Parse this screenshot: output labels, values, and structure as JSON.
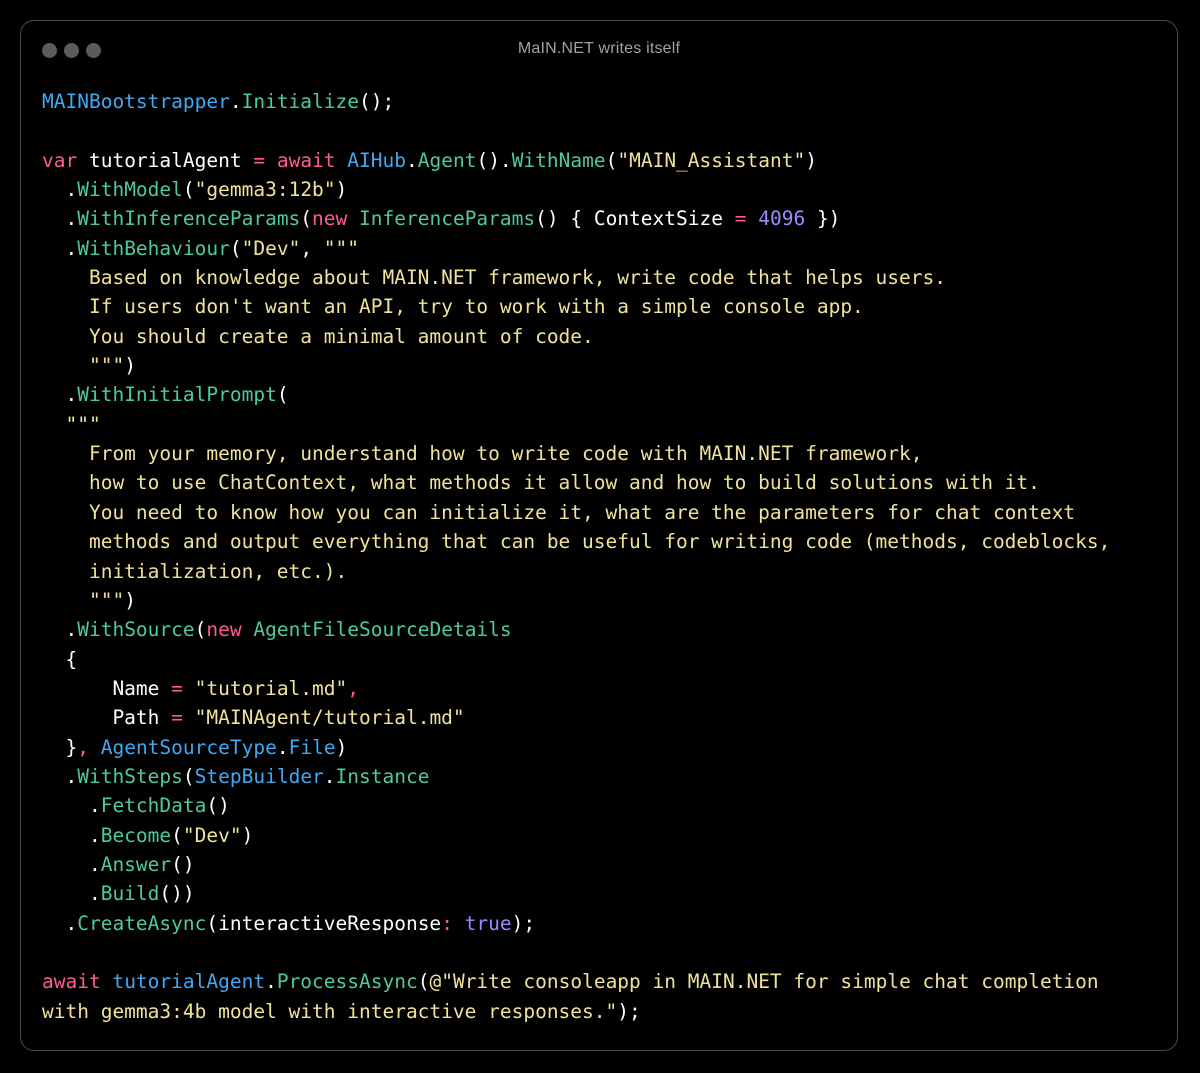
{
  "window": {
    "title": "MaIN.NET writes itself"
  },
  "colors": {
    "background": "#000000",
    "window_border": "#4a4a4c",
    "traffic_light": "#5b5b5e",
    "type": "#3fa9f5",
    "method": "#4ec9a4",
    "keyword": "#ff5c8a",
    "string": "#f0e29a",
    "number": "#9e88ff",
    "plain": "#ffffff"
  },
  "code": {
    "lines": [
      [
        [
          "type",
          "MAINBootstrapper"
        ],
        [
          "plain",
          "."
        ],
        [
          "method",
          "Initialize"
        ],
        [
          "plain",
          "();"
        ]
      ],
      [],
      [
        [
          "kw",
          "var"
        ],
        [
          "plain",
          " tutorialAgent "
        ],
        [
          "op",
          "="
        ],
        [
          "plain",
          " "
        ],
        [
          "kw",
          "await"
        ],
        [
          "plain",
          " "
        ],
        [
          "type",
          "AIHub"
        ],
        [
          "plain",
          "."
        ],
        [
          "method",
          "Agent"
        ],
        [
          "plain",
          "()."
        ],
        [
          "method",
          "WithName"
        ],
        [
          "plain",
          "("
        ],
        [
          "str",
          "\"MAIN_Assistant\""
        ],
        [
          "plain",
          ")"
        ]
      ],
      [
        [
          "plain",
          "  ."
        ],
        [
          "method",
          "WithModel"
        ],
        [
          "plain",
          "("
        ],
        [
          "str",
          "\"gemma3:12b\""
        ],
        [
          "plain",
          ")"
        ]
      ],
      [
        [
          "plain",
          "  ."
        ],
        [
          "method",
          "WithInferenceParams"
        ],
        [
          "plain",
          "("
        ],
        [
          "kw",
          "new"
        ],
        [
          "plain",
          " "
        ],
        [
          "method",
          "InferenceParams"
        ],
        [
          "plain",
          "() { ContextSize "
        ],
        [
          "op",
          "="
        ],
        [
          "plain",
          " "
        ],
        [
          "num",
          "4096"
        ],
        [
          "plain",
          " })"
        ]
      ],
      [
        [
          "plain",
          "  ."
        ],
        [
          "method",
          "WithBehaviour"
        ],
        [
          "plain",
          "("
        ],
        [
          "str",
          "\"Dev\""
        ],
        [
          "plain",
          ", "
        ],
        [
          "str",
          "\"\"\""
        ]
      ],
      [
        [
          "str",
          "    Based on knowledge about MAIN.NET framework, write code that helps users."
        ]
      ],
      [
        [
          "str",
          "    If users don't want an API, try to work with a simple console app."
        ]
      ],
      [
        [
          "str",
          "    You should create a minimal amount of code."
        ]
      ],
      [
        [
          "str",
          "    \"\"\""
        ],
        [
          "plain",
          ")"
        ]
      ],
      [
        [
          "plain",
          "  ."
        ],
        [
          "method",
          "WithInitialPrompt"
        ],
        [
          "plain",
          "("
        ]
      ],
      [
        [
          "str",
          "  \"\"\""
        ]
      ],
      [
        [
          "str",
          "    From your memory, understand how to write code with MAIN.NET framework,"
        ]
      ],
      [
        [
          "str",
          "    how to use ChatContext, what methods it allow and how to build solutions with it."
        ]
      ],
      [
        [
          "str",
          "    You need to know how you can initialize it, what are the parameters for chat context"
        ]
      ],
      [
        [
          "str",
          "    methods and output everything that can be useful for writing code (methods, codeblocks,"
        ]
      ],
      [
        [
          "str",
          "    initialization, etc.)."
        ]
      ],
      [
        [
          "str",
          "    \"\"\""
        ],
        [
          "plain",
          ")"
        ]
      ],
      [
        [
          "plain",
          "  ."
        ],
        [
          "method",
          "WithSource"
        ],
        [
          "plain",
          "("
        ],
        [
          "kw",
          "new"
        ],
        [
          "plain",
          " "
        ],
        [
          "method",
          "AgentFileSourceDetails"
        ]
      ],
      [
        [
          "plain",
          "  {"
        ]
      ],
      [
        [
          "plain",
          "      Name "
        ],
        [
          "op",
          "="
        ],
        [
          "plain",
          " "
        ],
        [
          "str",
          "\"tutorial.md\""
        ],
        [
          "op",
          ","
        ]
      ],
      [
        [
          "plain",
          "      Path "
        ],
        [
          "op",
          "="
        ],
        [
          "plain",
          " "
        ],
        [
          "str",
          "\"MAINAgent/tutorial.md\""
        ]
      ],
      [
        [
          "plain",
          "  }"
        ],
        [
          "op",
          ","
        ],
        [
          "plain",
          " "
        ],
        [
          "type",
          "AgentSourceType"
        ],
        [
          "plain",
          "."
        ],
        [
          "type",
          "File"
        ],
        [
          "plain",
          ")"
        ]
      ],
      [
        [
          "plain",
          "  ."
        ],
        [
          "method",
          "WithSteps"
        ],
        [
          "plain",
          "("
        ],
        [
          "type",
          "StepBuilder"
        ],
        [
          "plain",
          "."
        ],
        [
          "method",
          "Instance"
        ]
      ],
      [
        [
          "plain",
          "    ."
        ],
        [
          "method",
          "FetchData"
        ],
        [
          "plain",
          "()"
        ]
      ],
      [
        [
          "plain",
          "    ."
        ],
        [
          "method",
          "Become"
        ],
        [
          "plain",
          "("
        ],
        [
          "str",
          "\"Dev\""
        ],
        [
          "plain",
          ")"
        ]
      ],
      [
        [
          "plain",
          "    ."
        ],
        [
          "method",
          "Answer"
        ],
        [
          "plain",
          "()"
        ]
      ],
      [
        [
          "plain",
          "    ."
        ],
        [
          "method",
          "Build"
        ],
        [
          "plain",
          "())"
        ]
      ],
      [
        [
          "plain",
          "  ."
        ],
        [
          "method",
          "CreateAsync"
        ],
        [
          "plain",
          "(interactiveResponse"
        ],
        [
          "op",
          ":"
        ],
        [
          "plain",
          " "
        ],
        [
          "bool",
          "true"
        ],
        [
          "plain",
          ");"
        ]
      ],
      [],
      [
        [
          "kw",
          "await"
        ],
        [
          "plain",
          " "
        ],
        [
          "type",
          "tutorialAgent"
        ],
        [
          "plain",
          "."
        ],
        [
          "method",
          "ProcessAsync"
        ],
        [
          "plain",
          "("
        ],
        [
          "str",
          "@\"Write consoleapp in MAIN.NET for simple chat completion"
        ]
      ],
      [
        [
          "str",
          "with gemma3:4b model with interactive responses.\""
        ],
        [
          "plain",
          ");"
        ]
      ]
    ]
  }
}
